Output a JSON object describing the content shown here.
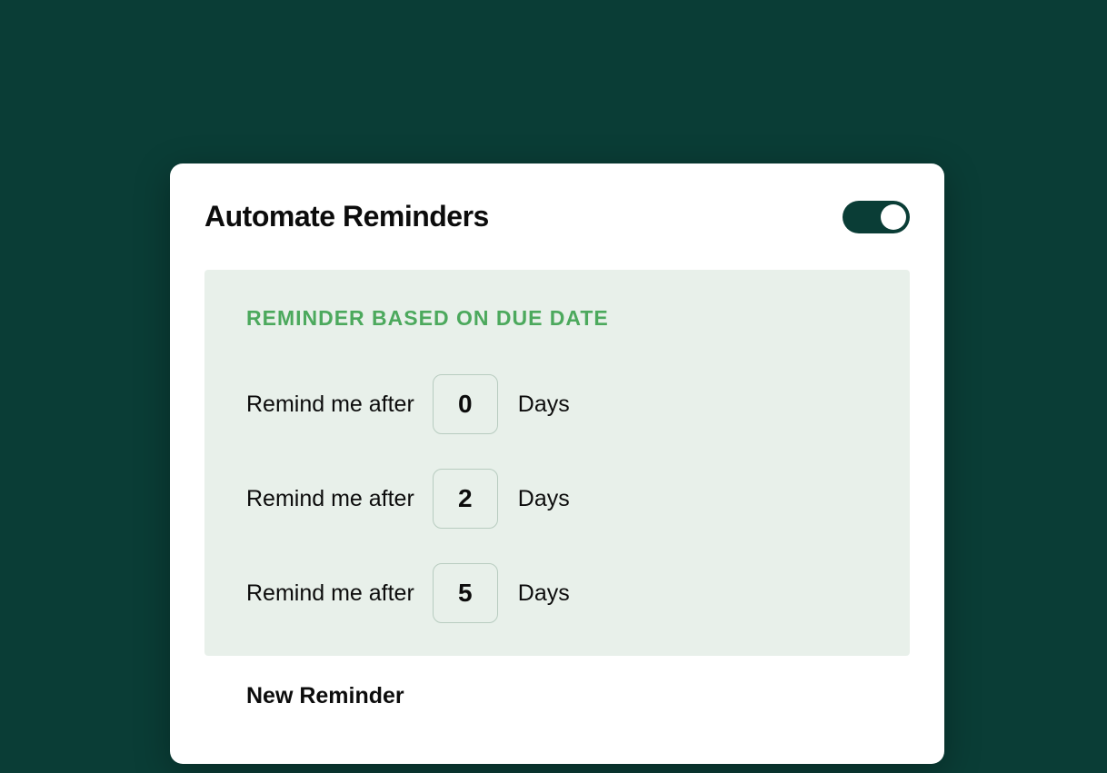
{
  "card": {
    "title": "Automate Reminders",
    "toggle_on": true
  },
  "section": {
    "title": "REMINDER BASED ON DUE DATE",
    "rows": [
      {
        "label_before": "Remind me after",
        "value": "0",
        "label_after": "Days"
      },
      {
        "label_before": "Remind me after",
        "value": "2",
        "label_after": "Days"
      },
      {
        "label_before": "Remind me after",
        "value": "5",
        "label_after": "Days"
      }
    ]
  },
  "new_reminder_label": "New Reminder"
}
